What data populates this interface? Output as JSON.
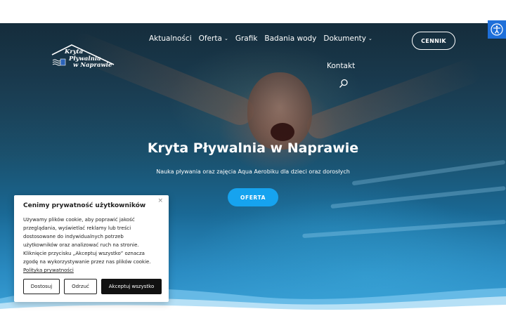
{
  "logo": {
    "line1": "Kryta",
    "line2": "Pływalnia",
    "line3": "w Naprawie"
  },
  "nav": {
    "items": [
      {
        "label": "Aktualności",
        "has_dropdown": false
      },
      {
        "label": "Oferta",
        "has_dropdown": true
      },
      {
        "label": "Grafik",
        "has_dropdown": false
      },
      {
        "label": "Badania wody",
        "has_dropdown": false
      },
      {
        "label": "Dokumenty",
        "has_dropdown": true
      }
    ],
    "kontakt": "Kontakt",
    "caret": "⌄"
  },
  "header_button": "CENNIK",
  "accessibility_icon": "accessibility-icon",
  "search_icon": "search-icon",
  "hero": {
    "title": "Kryta Pływalnia w Naprawie",
    "subtitle": "Nauka pływania oraz zajęcia Aqua Aerobiku dla dzieci oraz dorosłych",
    "button": "OFERTA"
  },
  "cookie": {
    "title": "Cenimy prywatność użytkowników",
    "close": "×",
    "text": "Używamy plików cookie, aby poprawić jakość przeglądania, wyświetlać reklamy lub treści dostosowane do indywidualnych potrzeb użytkowników oraz analizować ruch na stronie. Kliknięcie przycisku „Akceptuj wszystko” oznacza zgodę na wykorzystywanie przez nas plików cookie.",
    "link": "Polityka prywatności",
    "buttons": {
      "customize": "Dostosuj",
      "reject": "Odrzuć",
      "accept": "Akceptuj wszystko"
    }
  },
  "colors": {
    "accent": "#16a3ef",
    "a11y": "#1e6fd9",
    "dark_button": "#111111"
  }
}
